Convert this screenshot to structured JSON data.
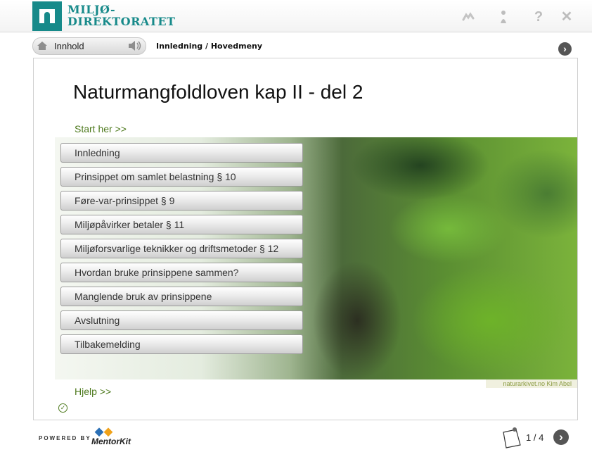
{
  "brand": {
    "line1": "MILJØ-",
    "line2": "DIREKTORATET",
    "accent": "#178a8a"
  },
  "toolbar": {
    "icons": [
      "bookmark-icon",
      "info-icon",
      "help-icon",
      "close-icon"
    ],
    "help_glyph": "?",
    "close_glyph": "✕"
  },
  "nav": {
    "home_label": "Innhold",
    "breadcrumb": "Innledning / Hovedmeny"
  },
  "main": {
    "title": "Naturmangfoldloven kap II - del 2",
    "start_link": "Start her  >>",
    "menu": [
      "Innledning",
      "Prinsippet om samlet belastning § 10",
      "Føre-var-prinsippet § 9",
      "Miljøpåvirker betaler § 11",
      "Miljøforsvarlige teknikker og driftsmetoder § 12",
      "Hvordan bruke prinsippene sammen?",
      "Manglende bruk av prinsippene",
      "Avslutning",
      "Tilbakemelding"
    ],
    "photo_credit": "naturarkivet.no Kim Abel",
    "help_link": "Hjelp >>",
    "link_color": "#4e7a1e"
  },
  "footer": {
    "powered_by": "POWERED BY",
    "product": "MentorKit",
    "page_indicator": "1 / 4"
  }
}
